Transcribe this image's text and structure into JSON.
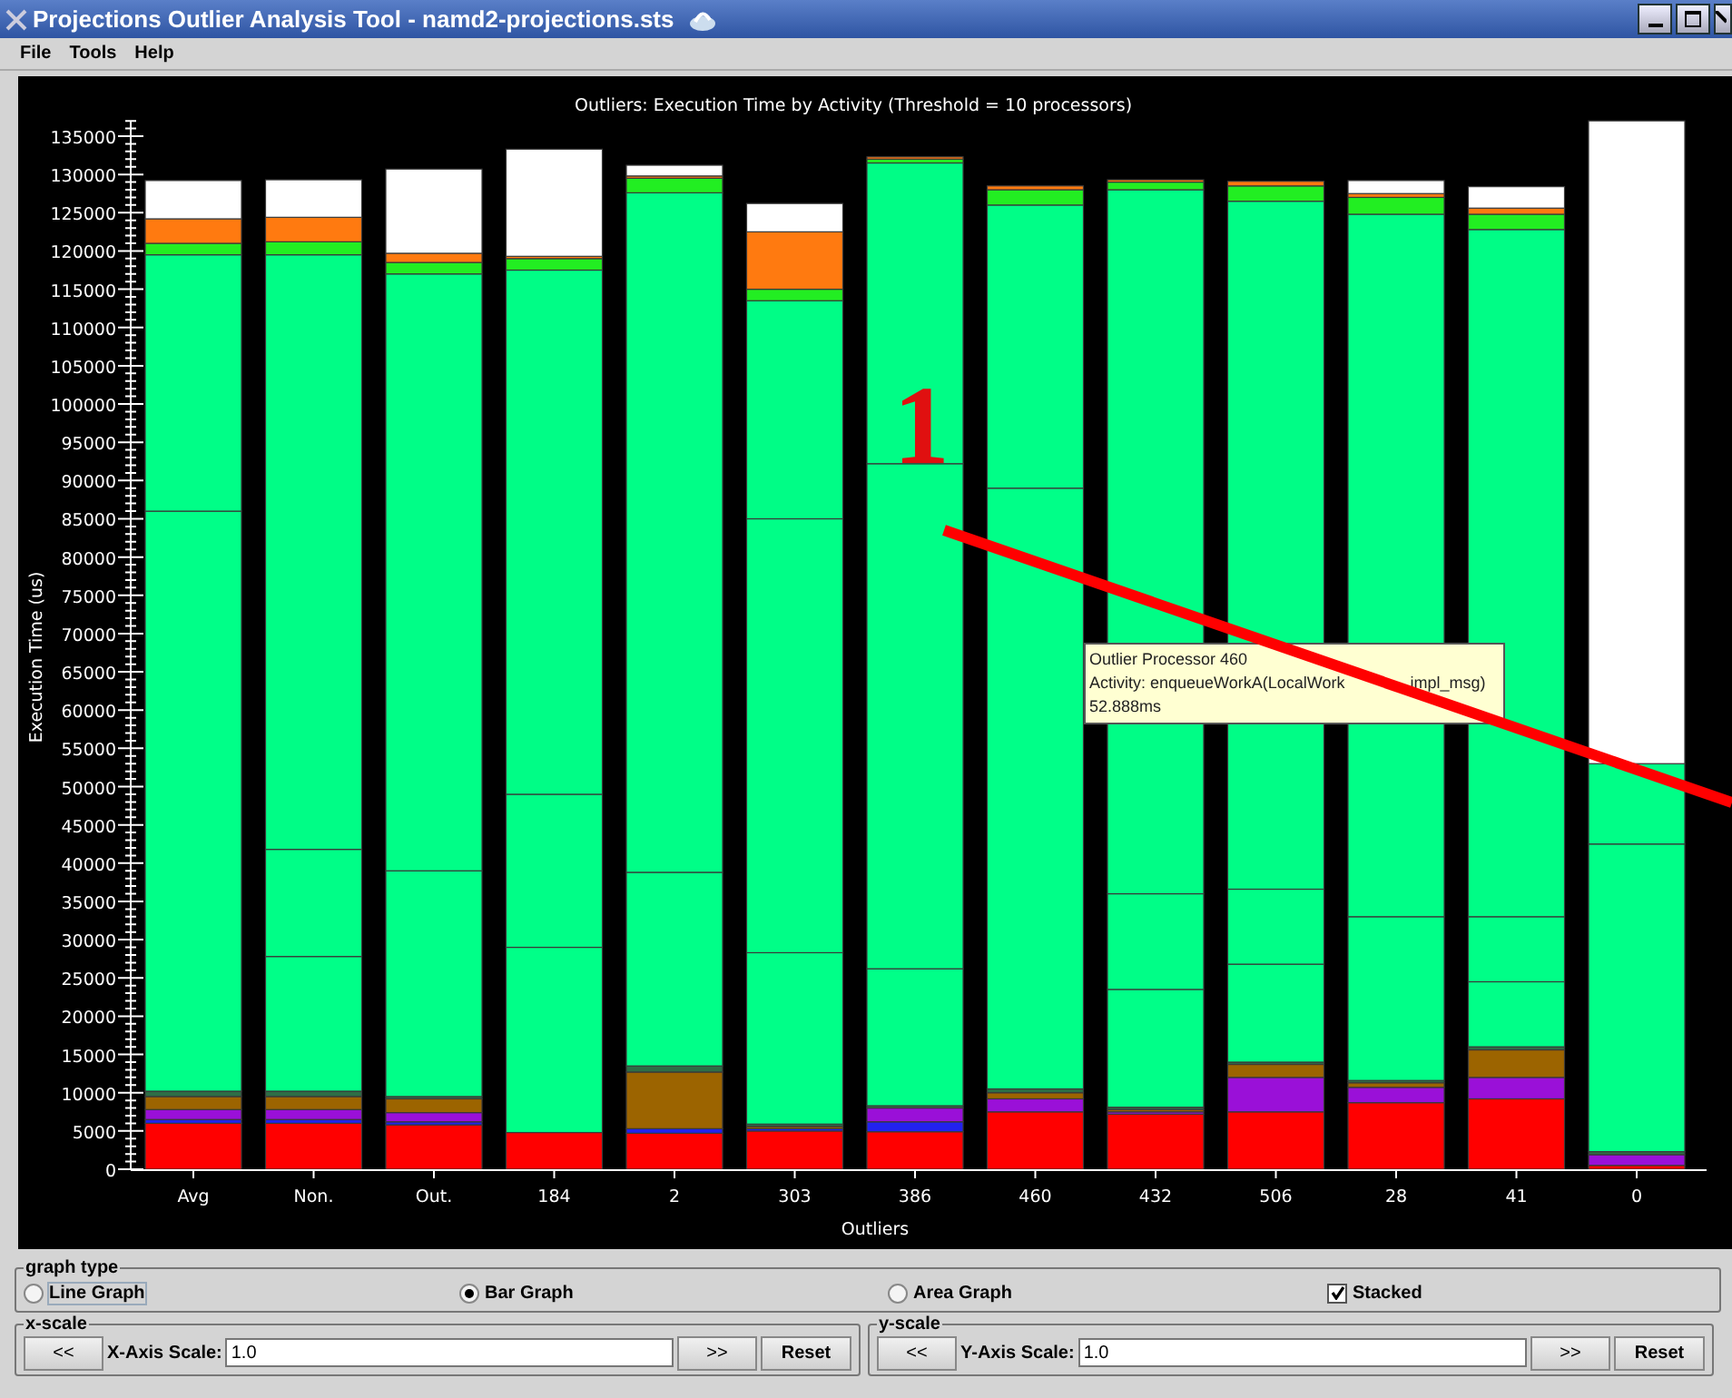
{
  "window": {
    "title": "Projections Outlier Analysis Tool - namd2-projections.sts"
  },
  "menu": [
    "File",
    "Tools",
    "Help"
  ],
  "chart": {
    "chart_data": {
      "type": "bar",
      "stacked": true,
      "title": "Outliers: Execution Time by Activity (Threshold = 10 processors)",
      "xlabel": "Outliers",
      "ylabel": "Execution Time (us)",
      "categories": [
        "Avg",
        "Non.",
        "Out.",
        "184",
        "2",
        "303",
        "386",
        "460",
        "432",
        "506",
        "28",
        "41",
        "0"
      ],
      "ylim": [
        0,
        137000
      ],
      "yticks": [
        0,
        5000,
        10000,
        15000,
        20000,
        25000,
        30000,
        35000,
        40000,
        45000,
        50000,
        55000,
        60000,
        65000,
        70000,
        75000,
        80000,
        85000,
        90000,
        95000,
        100000,
        105000,
        110000,
        115000,
        120000,
        125000,
        130000,
        135000
      ],
      "series": [
        {
          "color": "#ff0000",
          "values": [
            6000,
            6000,
            5800,
            4800,
            4700,
            5000,
            4900,
            7500,
            7200,
            7500,
            8700,
            9200,
            500
          ]
        },
        {
          "color": "#2222ee",
          "values": [
            500,
            500,
            400,
            0,
            600,
            300,
            1300,
            0,
            0,
            0,
            0,
            0,
            0
          ]
        },
        {
          "color": "#9a10d8",
          "values": [
            1300,
            1300,
            1200,
            0,
            0,
            0,
            1800,
            1700,
            300,
            4500,
            2000,
            2800,
            1400
          ]
        },
        {
          "color": "#9c6400",
          "values": [
            1700,
            1700,
            1800,
            0,
            7400,
            300,
            0,
            800,
            300,
            1700,
            600,
            3600,
            0
          ]
        },
        {
          "color": "#2e6e46",
          "values": [
            700,
            700,
            300,
            0,
            800,
            300,
            300,
            500,
            300,
            300,
            300,
            400,
            400
          ]
        },
        {
          "color": "#00ff88",
          "values": [
            75800,
            17600,
            29500,
            24200,
            25300,
            22400,
            17900,
            78500,
            15400,
            12800,
            21400,
            8500,
            40200
          ]
        },
        {
          "color": "#00fe87",
          "values": [
            33500,
            14000,
            78000,
            20000,
            88800,
            56700,
            66000,
            37000,
            12500,
            9800,
            91800,
            8500,
            10500
          ]
        },
        {
          "color": "#00fd86",
          "values": [
            0,
            77700,
            0,
            68500,
            0,
            28500,
            39300,
            0,
            92000,
            89900,
            0,
            89800,
            0
          ]
        },
        {
          "color": "#22ee22",
          "values": [
            1500,
            1700,
            1500,
            1500,
            1900,
            1500,
            500,
            2000,
            1000,
            2000,
            2200,
            2000,
            0
          ]
        },
        {
          "color": "#ff7a10",
          "values": [
            3200,
            3200,
            1200,
            300,
            300,
            7500,
            300,
            500,
            300,
            600,
            500,
            800,
            0
          ]
        },
        {
          "color": "#ffffff",
          "values": [
            5000,
            4900,
            11000,
            14000,
            1400,
            3700,
            0,
            0,
            0,
            0,
            1700,
            2800,
            84000
          ]
        }
      ]
    }
  },
  "tooltip": {
    "lines": [
      [
        "Outlier Processor 460"
      ],
      [
        "Activity: enqueueWorkA(LocalWork",
        "impl_msg)"
      ],
      [
        "52.888ms"
      ]
    ]
  },
  "annotation": {
    "label": "1"
  },
  "graph_type": {
    "title": "graph type",
    "options": [
      {
        "kind": "radio",
        "label": "Line Graph",
        "selected": false
      },
      {
        "kind": "radio",
        "label": "Bar Graph",
        "selected": true
      },
      {
        "kind": "radio",
        "label": "Area Graph",
        "selected": false
      },
      {
        "kind": "checkbox",
        "label": "Stacked",
        "checked": true
      }
    ]
  },
  "scales": [
    {
      "title": "x-scale",
      "prev": "<<",
      "label": "X-Axis Scale:",
      "value": "1.0",
      "next": ">>",
      "reset": "Reset"
    },
    {
      "title": "y-scale",
      "prev": "<<",
      "label": "Y-Axis Scale:",
      "value": "1.0",
      "next": ">>",
      "reset": "Reset"
    }
  ]
}
